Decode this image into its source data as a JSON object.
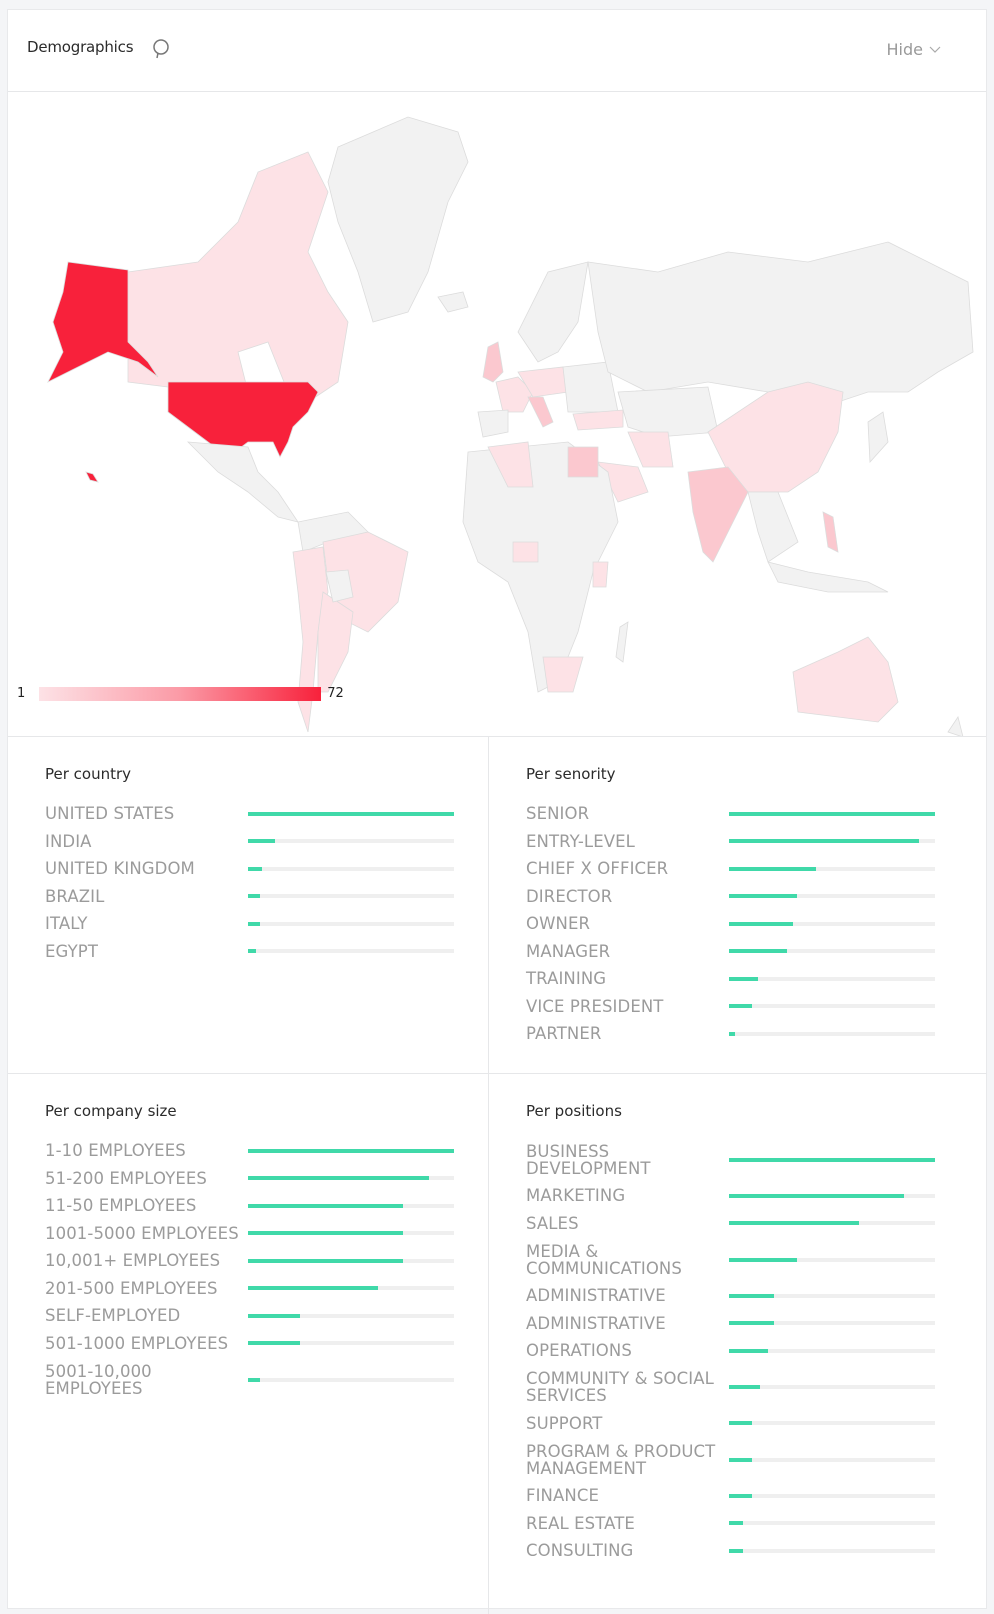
{
  "header": {
    "title": "Demographics",
    "hide_label": "Hide"
  },
  "colors": {
    "accent_bar": "#40d9a9",
    "map_max": "#f8213b",
    "map_min": "#fde2e6",
    "map_none": "#f2f2f2"
  },
  "map": {
    "legend_min": "1",
    "legend_max": "72",
    "highlighted_countries": [
      {
        "name": "United States",
        "intensity": 1.0
      },
      {
        "name": "India",
        "intensity": 0.2
      },
      {
        "name": "United Kingdom",
        "intensity": 0.12
      },
      {
        "name": "Brazil",
        "intensity": 0.08
      },
      {
        "name": "Italy",
        "intensity": 0.08
      },
      {
        "name": "Egypt",
        "intensity": 0.06
      },
      {
        "name": "Canada",
        "intensity": 0.04
      },
      {
        "name": "China",
        "intensity": 0.04
      },
      {
        "name": "Australia",
        "intensity": 0.04
      }
    ]
  },
  "sections": {
    "country": {
      "title": "Per country",
      "items": [
        {
          "label": "UNITED STATES",
          "value": 100
        },
        {
          "label": "INDIA",
          "value": 13
        },
        {
          "label": "UNITED KINGDOM",
          "value": 7
        },
        {
          "label": "BRAZIL",
          "value": 6
        },
        {
          "label": "ITALY",
          "value": 6
        },
        {
          "label": "EGYPT",
          "value": 4
        }
      ]
    },
    "seniority": {
      "title": "Per senority",
      "items": [
        {
          "label": "SENIOR",
          "value": 100
        },
        {
          "label": "ENTRY-LEVEL",
          "value": 92
        },
        {
          "label": "CHIEF X OFFICER",
          "value": 42
        },
        {
          "label": "DIRECTOR",
          "value": 33
        },
        {
          "label": "OWNER",
          "value": 31
        },
        {
          "label": "MANAGER",
          "value": 28
        },
        {
          "label": "TRAINING",
          "value": 14
        },
        {
          "label": "VICE PRESIDENT",
          "value": 11
        },
        {
          "label": "PARTNER",
          "value": 3
        }
      ]
    },
    "company_size": {
      "title": "Per company size",
      "items": [
        {
          "label": "1-10 EMPLOYEES",
          "value": 100
        },
        {
          "label": "51-200 EMPLOYEES",
          "value": 88
        },
        {
          "label": "11-50 EMPLOYEES",
          "value": 75
        },
        {
          "label": "1001-5000 EMPLOYEES",
          "value": 75
        },
        {
          "label": "10,001+ EMPLOYEES",
          "value": 75
        },
        {
          "label": "201-500 EMPLOYEES",
          "value": 63
        },
        {
          "label": "SELF-EMPLOYED",
          "value": 25
        },
        {
          "label": "501-1000 EMPLOYEES",
          "value": 25
        },
        {
          "label": "5001-10,000 EMPLOYEES",
          "value": 6,
          "tall": true
        }
      ]
    },
    "positions": {
      "title": "Per positions",
      "items": [
        {
          "label": "BUSINESS DEVELOPMENT",
          "value": 100,
          "tall": true
        },
        {
          "label": "MARKETING",
          "value": 85
        },
        {
          "label": "SALES",
          "value": 63
        },
        {
          "label": "MEDIA & COMMUNICATIONS",
          "value": 33,
          "tall": true
        },
        {
          "label": "ADMINISTRATIVE",
          "value": 22
        },
        {
          "label": "ADMINISTRATIVE",
          "value": 22
        },
        {
          "label": "OPERATIONS",
          "value": 19
        },
        {
          "label": "COMMUNITY & SOCIAL SERVICES",
          "value": 15,
          "tall": true
        },
        {
          "label": "SUPPORT",
          "value": 11
        },
        {
          "label": "PROGRAM & PRODUCT MANAGEMENT",
          "value": 11,
          "tall": true
        },
        {
          "label": "FINANCE",
          "value": 11
        },
        {
          "label": "REAL ESTATE",
          "value": 7
        },
        {
          "label": "CONSULTING",
          "value": 7
        }
      ]
    }
  }
}
